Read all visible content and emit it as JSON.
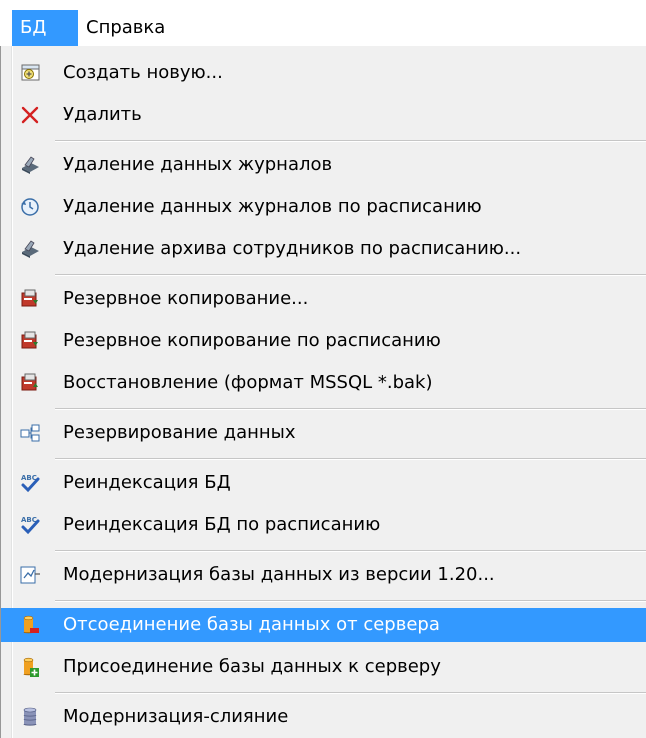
{
  "menubar": {
    "items": [
      {
        "label": "БД",
        "active": true
      },
      {
        "label": "Справка",
        "active": false
      }
    ]
  },
  "menu": {
    "items": [
      {
        "label": "Создать новую...",
        "icon": "create-db-icon"
      },
      {
        "label": "Удалить",
        "icon": "delete-x-icon"
      },
      {
        "label": "Удаление данных журналов",
        "icon": "clear-logs-icon"
      },
      {
        "label": "Удаление данных журналов по расписанию",
        "icon": "schedule-clear-logs-icon"
      },
      {
        "label": "Удаление архива сотрудников по расписанию...",
        "icon": "clear-archive-icon"
      },
      {
        "label": "Резервное копирование...",
        "icon": "backup-icon"
      },
      {
        "label": "Резервное копирование по расписанию",
        "icon": "backup-schedule-icon"
      },
      {
        "label": "Восстановление (формат MSSQL *.bak)",
        "icon": "restore-icon"
      },
      {
        "label": "Резервирование данных",
        "icon": "replication-icon"
      },
      {
        "label": "Реиндексация БД",
        "icon": "reindex-icon"
      },
      {
        "label": "Реиндексация БД по расписанию",
        "icon": "reindex-schedule-icon"
      },
      {
        "label": "Модернизация базы данных из версии 1.20...",
        "icon": "upgrade-db-icon"
      },
      {
        "label": "Отсоединение базы данных от сервера",
        "icon": "detach-db-icon",
        "highlighted": true
      },
      {
        "label": "Присоединение базы данных к серверу",
        "icon": "attach-db-icon"
      },
      {
        "label": "Модернизация-слияние",
        "icon": "merge-db-icon"
      }
    ]
  },
  "colors": {
    "highlight": "#3399ff",
    "menu_bg": "#f0f0f0",
    "separator": "#c6c6c6"
  }
}
